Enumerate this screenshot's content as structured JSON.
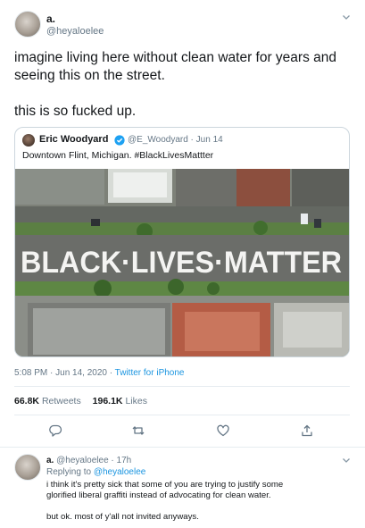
{
  "tweet": {
    "name": "a.",
    "handle": "@heyaloelee",
    "text_line1": "imagine living here without clean water for years and",
    "text_line2": "seeing this on the street.",
    "text_line3": "this is so fucked up.",
    "timestamp": "5:08 PM · Jun 14, 2020 · ",
    "source": "Twitter for iPhone",
    "retweets_count": "66.8K",
    "retweets_label": "Retweets",
    "likes_count": "196.1K",
    "likes_label": "Likes"
  },
  "quoted": {
    "name": "Eric Woodyard",
    "meta": "@E_Woodyard · Jun 14",
    "text": "Downtown Flint, Michigan. #BlackLivesMattter",
    "photo_street_text": "BLACK·LIVES·MATTER"
  },
  "reply": {
    "name": "a.",
    "meta": "@heyaloelee · 17h",
    "replying_prefix": "Replying to ",
    "replying_mention": "@heyaloelee",
    "line1": "i think it's pretty sick that some of you are trying to justify some",
    "line2": "glorified liberal graffiti instead of advocating for clean water.",
    "line3": "but ok. most of y'all not invited anyways."
  },
  "icons": {
    "caret": "chevron-down-icon",
    "verified": "verified-badge-icon",
    "reply": "reply-icon",
    "retweet": "retweet-icon",
    "like": "heart-icon",
    "share": "share-icon"
  },
  "colors": {
    "link": "#1b95e0",
    "muted": "#657786",
    "text": "#14171a",
    "border": "#e6ecf0"
  }
}
